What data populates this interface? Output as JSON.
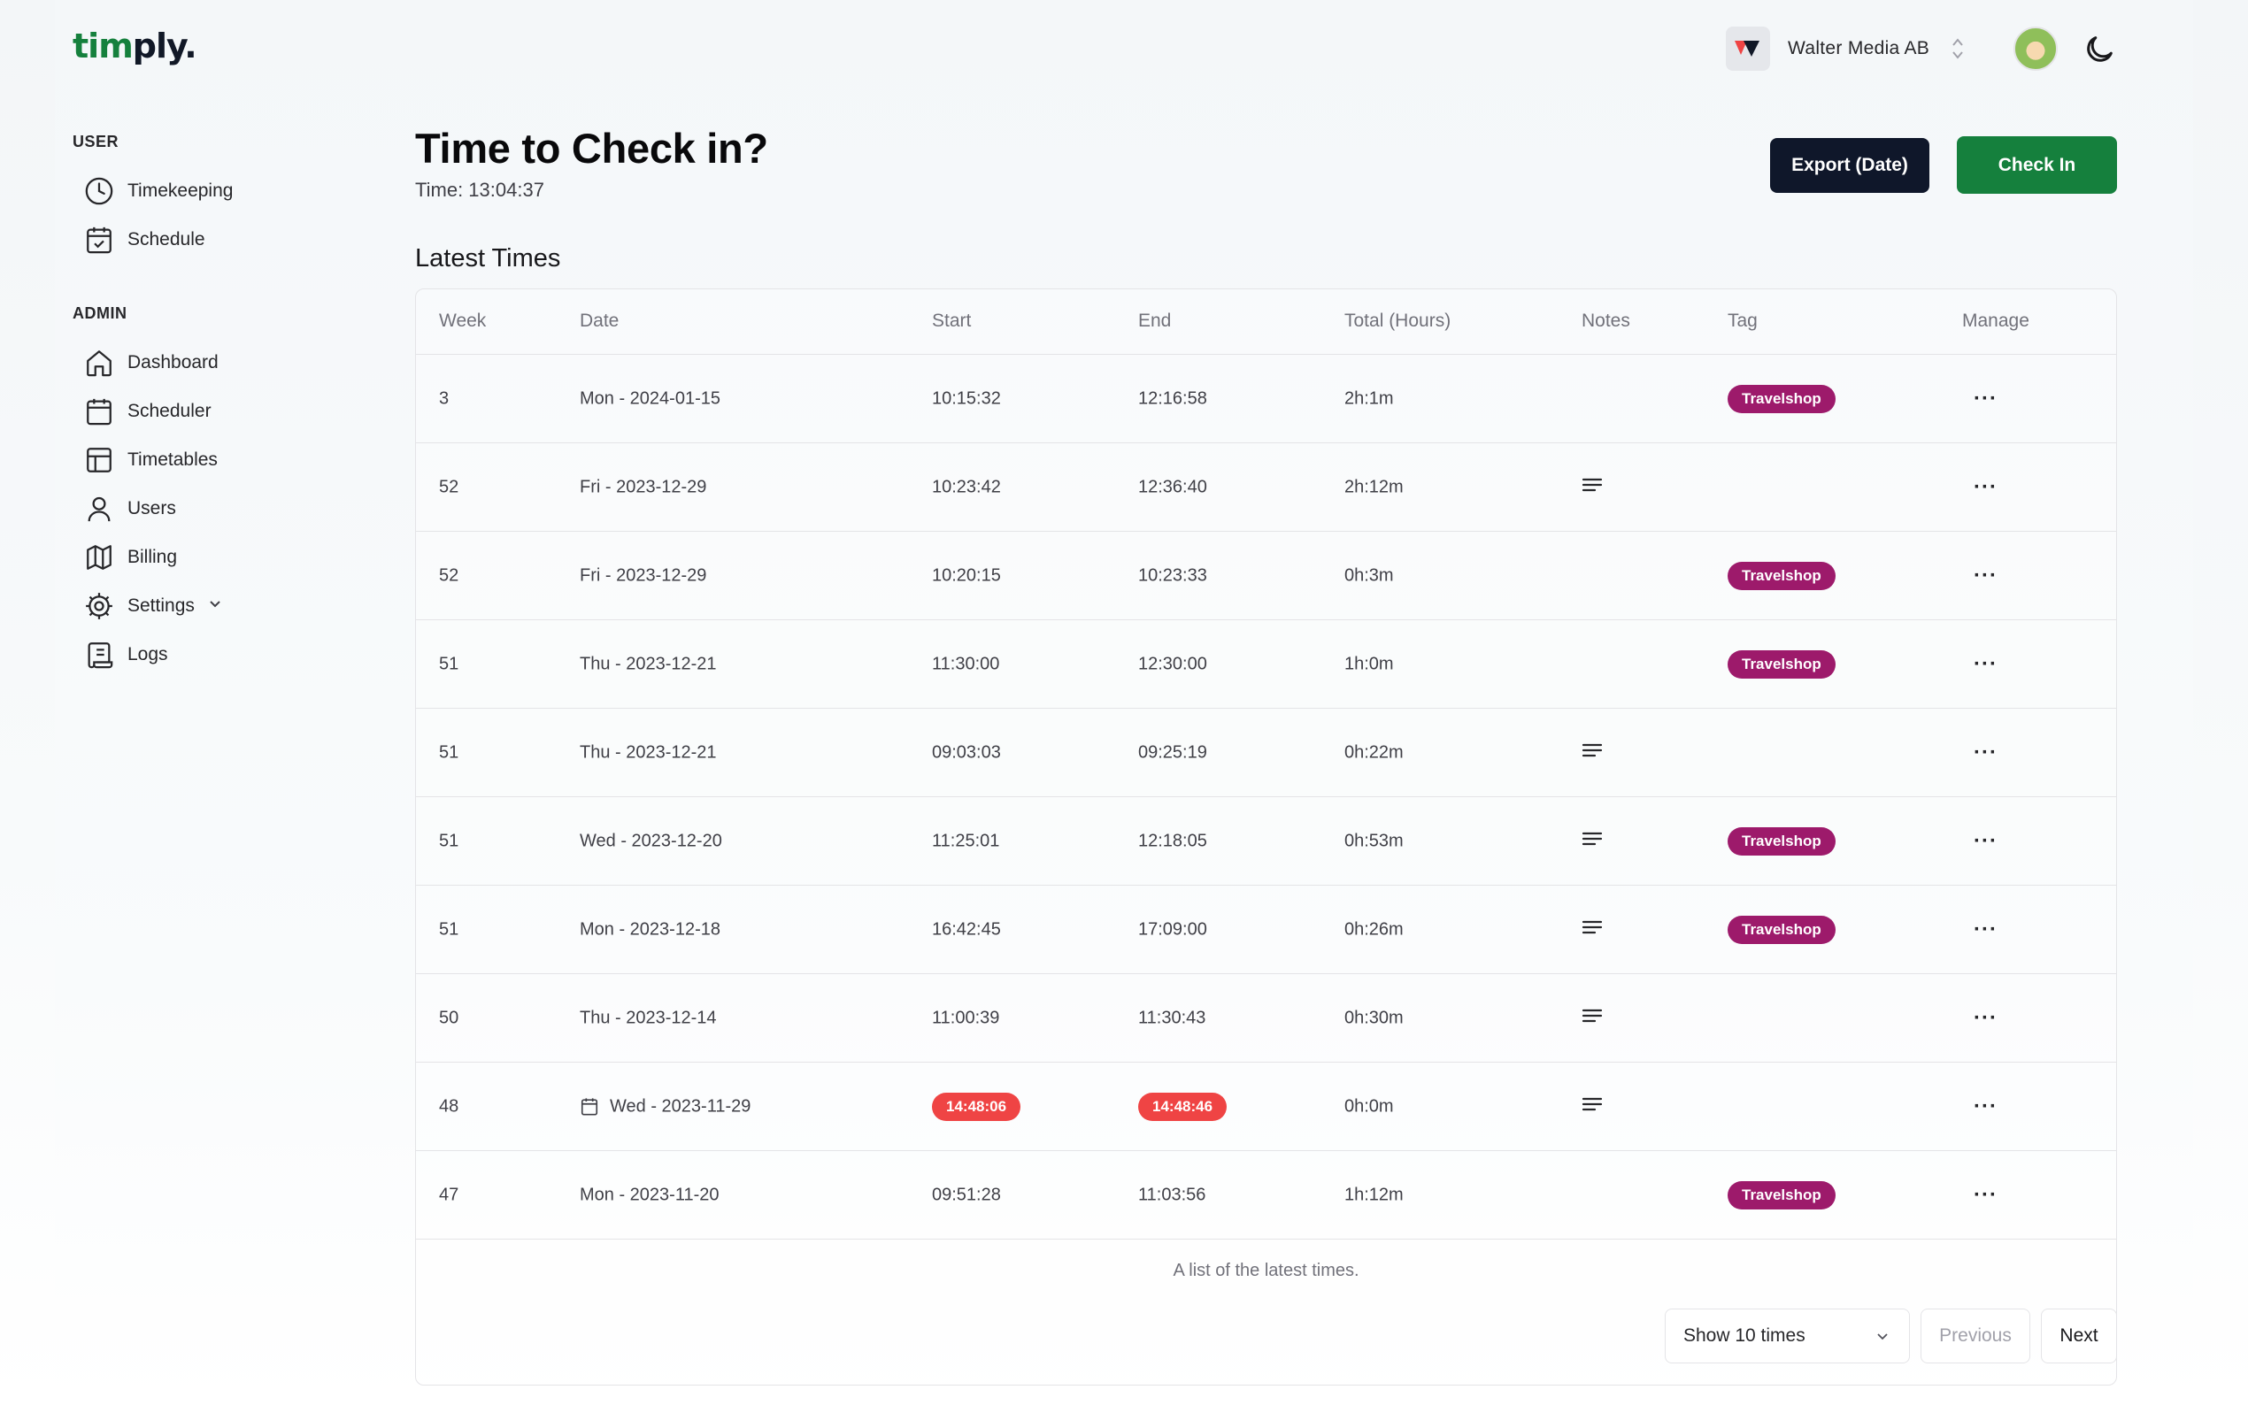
{
  "header": {
    "logo_prefix": "tim",
    "logo_suffix": "ply.",
    "org_name": "Walter Media AB"
  },
  "sidebar": {
    "user_label": "USER",
    "user_items": [
      {
        "label": "Timekeeping",
        "icon": "clock-icon"
      },
      {
        "label": "Schedule",
        "icon": "calendar-check-icon"
      }
    ],
    "admin_label": "ADMIN",
    "admin_items": [
      {
        "label": "Dashboard",
        "icon": "home-icon"
      },
      {
        "label": "Scheduler",
        "icon": "calendar-icon"
      },
      {
        "label": "Timetables",
        "icon": "table-icon"
      },
      {
        "label": "Users",
        "icon": "user-icon"
      },
      {
        "label": "Billing",
        "icon": "map-icon"
      },
      {
        "label": "Settings",
        "icon": "gear-icon"
      },
      {
        "label": "Logs",
        "icon": "scroll-icon"
      }
    ]
  },
  "main": {
    "title": "Time to Check in?",
    "time_line": "Time: 13:04:37",
    "export_label": "Export (Date)",
    "checkin_label": "Check In",
    "subtitle": "Latest Times"
  },
  "table": {
    "headers": {
      "week": "Week",
      "date": "Date",
      "start": "Start",
      "end": "End",
      "total": "Total (Hours)",
      "notes": "Notes",
      "tag": "Tag",
      "manage": "Manage"
    },
    "rows": [
      {
        "week": "3",
        "date": "Mon - 2024-01-15",
        "start": "10:15:32",
        "end": "12:16:58",
        "total": "2h:1m",
        "notes": false,
        "tag": "Travelshop",
        "flagged": false
      },
      {
        "week": "52",
        "date": "Fri - 2023-12-29",
        "start": "10:23:42",
        "end": "12:36:40",
        "total": "2h:12m",
        "notes": true,
        "tag": "",
        "flagged": false
      },
      {
        "week": "52",
        "date": "Fri - 2023-12-29",
        "start": "10:20:15",
        "end": "10:23:33",
        "total": "0h:3m",
        "notes": false,
        "tag": "Travelshop",
        "flagged": false
      },
      {
        "week": "51",
        "date": "Thu - 2023-12-21",
        "start": "11:30:00",
        "end": "12:30:00",
        "total": "1h:0m",
        "notes": false,
        "tag": "Travelshop",
        "flagged": false
      },
      {
        "week": "51",
        "date": "Thu - 2023-12-21",
        "start": "09:03:03",
        "end": "09:25:19",
        "total": "0h:22m",
        "notes": true,
        "tag": "",
        "flagged": false
      },
      {
        "week": "51",
        "date": "Wed - 2023-12-20",
        "start": "11:25:01",
        "end": "12:18:05",
        "total": "0h:53m",
        "notes": true,
        "tag": "Travelshop",
        "flagged": false
      },
      {
        "week": "51",
        "date": "Mon - 2023-12-18",
        "start": "16:42:45",
        "end": "17:09:00",
        "total": "0h:26m",
        "notes": true,
        "tag": "Travelshop",
        "flagged": false
      },
      {
        "week": "50",
        "date": "Thu - 2023-12-14",
        "start": "11:00:39",
        "end": "11:30:43",
        "total": "0h:30m",
        "notes": true,
        "tag": "",
        "flagged": false
      },
      {
        "week": "48",
        "date": "Wed - 2023-11-29",
        "start": "14:48:06",
        "end": "14:48:46",
        "total": "0h:0m",
        "notes": true,
        "tag": "",
        "flagged": true
      },
      {
        "week": "47",
        "date": "Mon - 2023-11-20",
        "start": "09:51:28",
        "end": "11:03:56",
        "total": "1h:12m",
        "notes": false,
        "tag": "Travelshop",
        "flagged": false
      }
    ],
    "manage_glyph": "···",
    "caption": "A list of the latest times.",
    "page_size_label": "Show 10 times",
    "prev_label": "Previous",
    "next_label": "Next"
  },
  "colors": {
    "brand_green": "#15803d",
    "export_dark": "#0f172a",
    "tag_magenta": "#9d1a6b",
    "alert_red": "#ef4444"
  }
}
